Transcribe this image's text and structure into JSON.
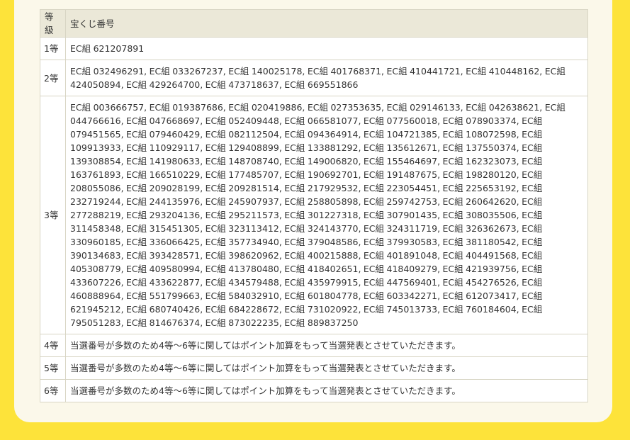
{
  "table": {
    "headers": [
      "等級",
      "宝くじ番号"
    ],
    "rows": [
      {
        "grade": "1等",
        "numbers": "EC組 621207891"
      },
      {
        "grade": "2等",
        "numbers": "EC組 032496291, EC組 033267237, EC組 140025178, EC組 401768371, EC組 410441721, EC組 410448162, EC組 424050894, EC組 429264700, EC組 473718637, EC組 669551866"
      },
      {
        "grade": "3等",
        "numbers": "EC組 003666757, EC組 019387686, EC組 020419886, EC組 027353635, EC組 029146133, EC組 042638621, EC組 044766616, EC組 047668697, EC組 052409448, EC組 066581077, EC組 077560018, EC組 078903374, EC組 079451565, EC組 079460429, EC組 082112504, EC組 094364914, EC組 104721385, EC組 108072598, EC組 109913933, EC組 110929117, EC組 129408899, EC組 133881292, EC組 135612671, EC組 137550374, EC組 139308854, EC組 141980633, EC組 148708740, EC組 149006820, EC組 155464697, EC組 162323073, EC組 163761893, EC組 166510229, EC組 177485707, EC組 190692701, EC組 191487675, EC組 198280120, EC組 208055086, EC組 209028199, EC組 209281514, EC組 217929532, EC組 223054451, EC組 225653192, EC組 232719244, EC組 244135976, EC組 245907937, EC組 258805898, EC組 259742753, EC組 260642620, EC組 277288219, EC組 293204136, EC組 295211573, EC組 301227318, EC組 307901435, EC組 308035506, EC組 311458348, EC組 315451305, EC組 323113412, EC組 324143770, EC組 324311719, EC組 326362673, EC組 330960185, EC組 336066425, EC組 357734940, EC組 379048586, EC組 379930583, EC組 381180542, EC組 390134683, EC組 393428571, EC組 398620962, EC組 400215888, EC組 401891048, EC組 404491568, EC組 405308779, EC組 409580994, EC組 413780480, EC組 418402651, EC組 418409279, EC組 421939756, EC組 433607226, EC組 433622877, EC組 434579488, EC組 435979915, EC組 447569401, EC組 454276526, EC組 460888964, EC組 551799663, EC組 584032910, EC組 601804778, EC組 603342271, EC組 612073417, EC組 621945212, EC組 680740426, EC組 684228672, EC組 731020922, EC組 745013733, EC組 760184604, EC組 795051283, EC組 814676374, EC組 873022235, EC組 889837250"
      },
      {
        "grade": "4等",
        "numbers": "当選番号が多数のため4等～6等に関してはポイント加算をもって当選発表とさせていただきます。"
      },
      {
        "grade": "5等",
        "numbers": "当選番号が多数のため4等～6等に関してはポイント加算をもって当選発表とさせていただきます。"
      },
      {
        "grade": "6等",
        "numbers": "当選番号が多数のため4等～6等に関してはポイント加算をもって当選発表とさせていただきます。"
      }
    ]
  }
}
